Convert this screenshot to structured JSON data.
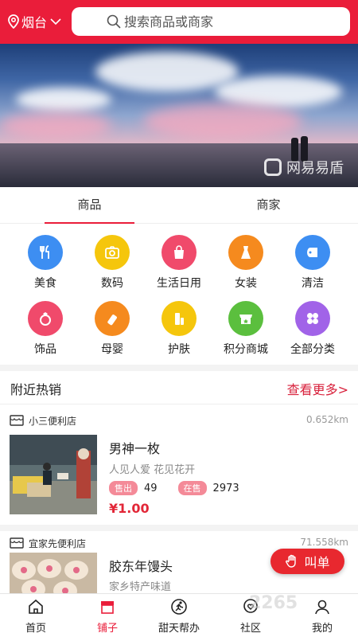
{
  "header": {
    "location": "烟台",
    "search_placeholder": "搜索商品或商家"
  },
  "banner": {
    "watermark": "网易易盾"
  },
  "tabs": [
    {
      "label": "商品",
      "active": true
    },
    {
      "label": "商家",
      "active": false
    }
  ],
  "categories": [
    {
      "label": "美食",
      "icon": "fork-knife-icon",
      "color": "#3d8ef2",
      "glyph": "🍴"
    },
    {
      "label": "数码",
      "icon": "camera-icon",
      "color": "#f5c60c",
      "glyph": "📷"
    },
    {
      "label": "生活日用",
      "icon": "bag-icon",
      "color": "#f04a6b",
      "glyph": "🛍"
    },
    {
      "label": "女装",
      "icon": "dress-icon",
      "color": "#f58a1e",
      "glyph": "👗"
    },
    {
      "label": "清洁",
      "icon": "tissue-roll-icon",
      "color": "#3d8ef2",
      "glyph": "🧻"
    },
    {
      "label": "饰品",
      "icon": "ring-icon",
      "color": "#f04a6b",
      "glyph": "💍"
    },
    {
      "label": "母婴",
      "icon": "baby-bottle-icon",
      "color": "#f58a1e",
      "glyph": "🍼"
    },
    {
      "label": "护肤",
      "icon": "cosmetics-icon",
      "color": "#f5c60c",
      "glyph": "🧴"
    },
    {
      "label": "积分商城",
      "icon": "shop-star-icon",
      "color": "#5bbf3e",
      "glyph": "⭐"
    },
    {
      "label": "全部分类",
      "icon": "grid-clover-icon",
      "color": "#a163e8",
      "glyph": "✤"
    }
  ],
  "nearby": {
    "title": "附近热销",
    "more": "查看更多>"
  },
  "shops": [
    {
      "name": "小三便利店",
      "distance": "0.652km",
      "product": {
        "name": "男神一枚",
        "desc": "人见人爱 花见花开",
        "sold_label": "售出",
        "sold": "49",
        "stock_label": "在售",
        "stock": "2973",
        "price": "¥1.00"
      }
    },
    {
      "name": "宜家先便利店",
      "distance": "71.558km",
      "product": {
        "name": "胶东年馒头",
        "desc": "家乡特产味道"
      }
    }
  ],
  "fab": {
    "label": "叫单"
  },
  "bottom_nav": [
    {
      "label": "首页",
      "icon": "home-icon",
      "active": false
    },
    {
      "label": "铺子",
      "icon": "store-icon",
      "active": true
    },
    {
      "label": "甜天帮办",
      "icon": "runner-icon",
      "active": false
    },
    {
      "label": "社区",
      "icon": "chat-heart-icon",
      "active": false
    },
    {
      "label": "我的",
      "icon": "user-icon",
      "active": false
    }
  ],
  "brand_watermark": "2265"
}
